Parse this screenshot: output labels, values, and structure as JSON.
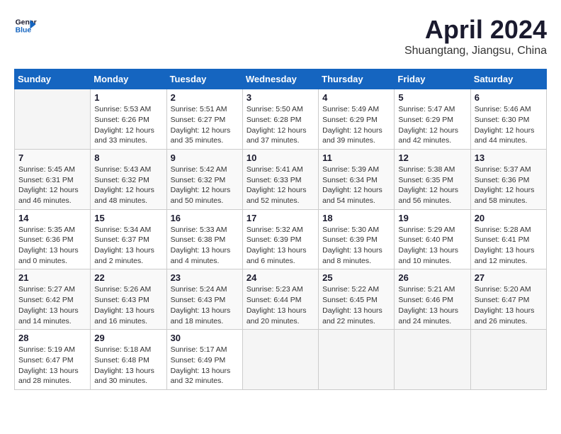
{
  "header": {
    "logo_line1": "General",
    "logo_line2": "Blue",
    "month": "April 2024",
    "location": "Shuangtang, Jiangsu, China"
  },
  "days_of_week": [
    "Sunday",
    "Monday",
    "Tuesday",
    "Wednesday",
    "Thursday",
    "Friday",
    "Saturday"
  ],
  "weeks": [
    [
      {
        "day": "",
        "info": ""
      },
      {
        "day": "1",
        "info": "Sunrise: 5:53 AM\nSunset: 6:26 PM\nDaylight: 12 hours\nand 33 minutes."
      },
      {
        "day": "2",
        "info": "Sunrise: 5:51 AM\nSunset: 6:27 PM\nDaylight: 12 hours\nand 35 minutes."
      },
      {
        "day": "3",
        "info": "Sunrise: 5:50 AM\nSunset: 6:28 PM\nDaylight: 12 hours\nand 37 minutes."
      },
      {
        "day": "4",
        "info": "Sunrise: 5:49 AM\nSunset: 6:29 PM\nDaylight: 12 hours\nand 39 minutes."
      },
      {
        "day": "5",
        "info": "Sunrise: 5:47 AM\nSunset: 6:29 PM\nDaylight: 12 hours\nand 42 minutes."
      },
      {
        "day": "6",
        "info": "Sunrise: 5:46 AM\nSunset: 6:30 PM\nDaylight: 12 hours\nand 44 minutes."
      }
    ],
    [
      {
        "day": "7",
        "info": "Sunrise: 5:45 AM\nSunset: 6:31 PM\nDaylight: 12 hours\nand 46 minutes."
      },
      {
        "day": "8",
        "info": "Sunrise: 5:43 AM\nSunset: 6:32 PM\nDaylight: 12 hours\nand 48 minutes."
      },
      {
        "day": "9",
        "info": "Sunrise: 5:42 AM\nSunset: 6:32 PM\nDaylight: 12 hours\nand 50 minutes."
      },
      {
        "day": "10",
        "info": "Sunrise: 5:41 AM\nSunset: 6:33 PM\nDaylight: 12 hours\nand 52 minutes."
      },
      {
        "day": "11",
        "info": "Sunrise: 5:39 AM\nSunset: 6:34 PM\nDaylight: 12 hours\nand 54 minutes."
      },
      {
        "day": "12",
        "info": "Sunrise: 5:38 AM\nSunset: 6:35 PM\nDaylight: 12 hours\nand 56 minutes."
      },
      {
        "day": "13",
        "info": "Sunrise: 5:37 AM\nSunset: 6:36 PM\nDaylight: 12 hours\nand 58 minutes."
      }
    ],
    [
      {
        "day": "14",
        "info": "Sunrise: 5:35 AM\nSunset: 6:36 PM\nDaylight: 13 hours\nand 0 minutes."
      },
      {
        "day": "15",
        "info": "Sunrise: 5:34 AM\nSunset: 6:37 PM\nDaylight: 13 hours\nand 2 minutes."
      },
      {
        "day": "16",
        "info": "Sunrise: 5:33 AM\nSunset: 6:38 PM\nDaylight: 13 hours\nand 4 minutes."
      },
      {
        "day": "17",
        "info": "Sunrise: 5:32 AM\nSunset: 6:39 PM\nDaylight: 13 hours\nand 6 minutes."
      },
      {
        "day": "18",
        "info": "Sunrise: 5:30 AM\nSunset: 6:39 PM\nDaylight: 13 hours\nand 8 minutes."
      },
      {
        "day": "19",
        "info": "Sunrise: 5:29 AM\nSunset: 6:40 PM\nDaylight: 13 hours\nand 10 minutes."
      },
      {
        "day": "20",
        "info": "Sunrise: 5:28 AM\nSunset: 6:41 PM\nDaylight: 13 hours\nand 12 minutes."
      }
    ],
    [
      {
        "day": "21",
        "info": "Sunrise: 5:27 AM\nSunset: 6:42 PM\nDaylight: 13 hours\nand 14 minutes."
      },
      {
        "day": "22",
        "info": "Sunrise: 5:26 AM\nSunset: 6:43 PM\nDaylight: 13 hours\nand 16 minutes."
      },
      {
        "day": "23",
        "info": "Sunrise: 5:24 AM\nSunset: 6:43 PM\nDaylight: 13 hours\nand 18 minutes."
      },
      {
        "day": "24",
        "info": "Sunrise: 5:23 AM\nSunset: 6:44 PM\nDaylight: 13 hours\nand 20 minutes."
      },
      {
        "day": "25",
        "info": "Sunrise: 5:22 AM\nSunset: 6:45 PM\nDaylight: 13 hours\nand 22 minutes."
      },
      {
        "day": "26",
        "info": "Sunrise: 5:21 AM\nSunset: 6:46 PM\nDaylight: 13 hours\nand 24 minutes."
      },
      {
        "day": "27",
        "info": "Sunrise: 5:20 AM\nSunset: 6:47 PM\nDaylight: 13 hours\nand 26 minutes."
      }
    ],
    [
      {
        "day": "28",
        "info": "Sunrise: 5:19 AM\nSunset: 6:47 PM\nDaylight: 13 hours\nand 28 minutes."
      },
      {
        "day": "29",
        "info": "Sunrise: 5:18 AM\nSunset: 6:48 PM\nDaylight: 13 hours\nand 30 minutes."
      },
      {
        "day": "30",
        "info": "Sunrise: 5:17 AM\nSunset: 6:49 PM\nDaylight: 13 hours\nand 32 minutes."
      },
      {
        "day": "",
        "info": ""
      },
      {
        "day": "",
        "info": ""
      },
      {
        "day": "",
        "info": ""
      },
      {
        "day": "",
        "info": ""
      }
    ]
  ]
}
